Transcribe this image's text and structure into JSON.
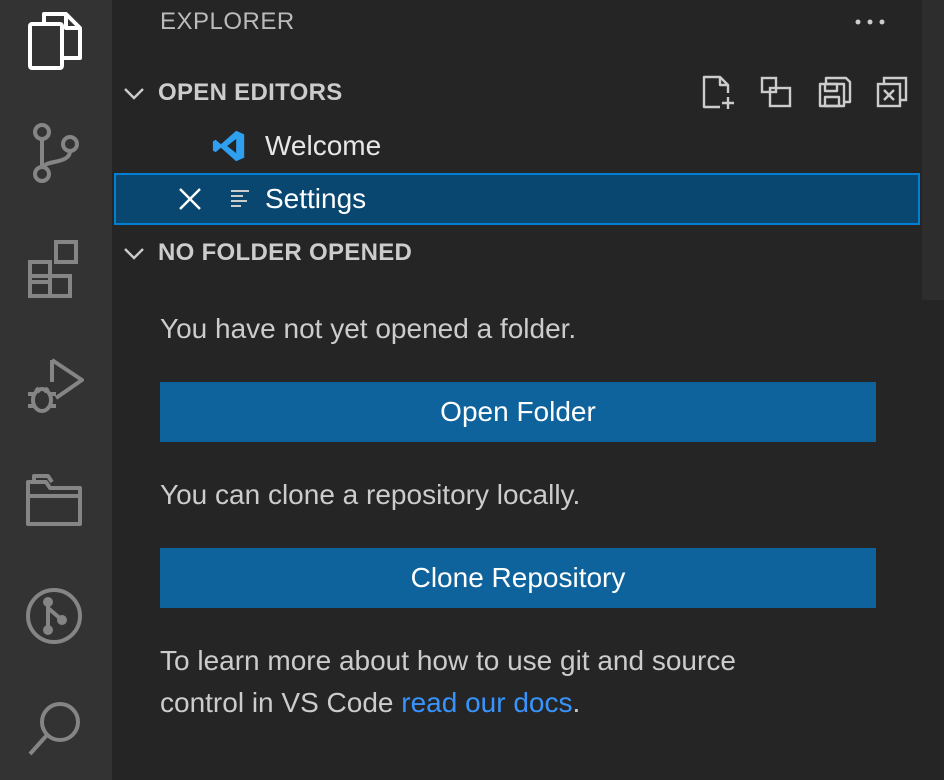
{
  "activity_bar": {
    "icons": [
      "files-icon",
      "source-control-icon",
      "extensions-icon",
      "run-debug-icon",
      "remote-explorer-icon",
      "git-graph-icon",
      "search-icon"
    ]
  },
  "explorer": {
    "title": "EXPLORER",
    "more_actions": "more-actions-icon"
  },
  "open_editors": {
    "header": "OPEN EDITORS",
    "items": [
      {
        "label": "Welcome",
        "icon": "vscode-logo-icon"
      },
      {
        "label": "Settings",
        "icon": "settings-file-icon",
        "selected": true
      }
    ],
    "toolbar": [
      "new-untitled-file-icon",
      "toggle-vertical-layout-icon",
      "save-all-icon",
      "close-all-icon"
    ]
  },
  "no_folder": {
    "header": "NO FOLDER OPENED",
    "message1": "You have not yet opened a folder.",
    "open_folder_label": "Open Folder",
    "message2": "You can clone a repository locally.",
    "clone_label": "Clone Repository",
    "message3_line1": "To learn more about how to use git and source",
    "message3_line2_prefix": "control in VS Code ",
    "docs_link": "read our docs",
    "message3_suffix": "."
  },
  "colors": {
    "activity_bar": "#333333",
    "sidebar": "#252526",
    "button": "#0e639c",
    "selection": "#094771",
    "focus_border": "#007fd4",
    "link": "#3794ff",
    "vscode_blue": "#2f9ff0"
  }
}
